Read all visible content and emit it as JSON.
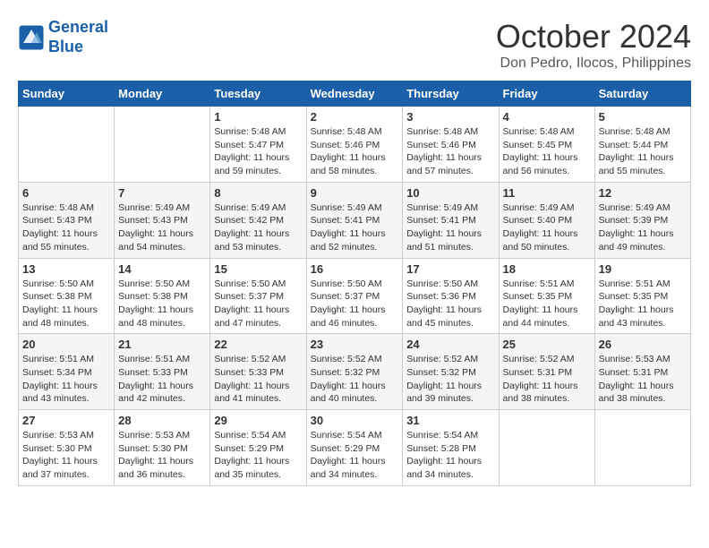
{
  "header": {
    "logo_line1": "General",
    "logo_line2": "Blue",
    "month_year": "October 2024",
    "location": "Don Pedro, Ilocos, Philippines"
  },
  "days_of_week": [
    "Sunday",
    "Monday",
    "Tuesday",
    "Wednesday",
    "Thursday",
    "Friday",
    "Saturday"
  ],
  "weeks": [
    [
      {
        "day": "",
        "info": ""
      },
      {
        "day": "",
        "info": ""
      },
      {
        "day": "1",
        "sunrise": "5:48 AM",
        "sunset": "5:47 PM",
        "daylight": "11 hours and 59 minutes."
      },
      {
        "day": "2",
        "sunrise": "5:48 AM",
        "sunset": "5:46 PM",
        "daylight": "11 hours and 58 minutes."
      },
      {
        "day": "3",
        "sunrise": "5:48 AM",
        "sunset": "5:46 PM",
        "daylight": "11 hours and 57 minutes."
      },
      {
        "day": "4",
        "sunrise": "5:48 AM",
        "sunset": "5:45 PM",
        "daylight": "11 hours and 56 minutes."
      },
      {
        "day": "5",
        "sunrise": "5:48 AM",
        "sunset": "5:44 PM",
        "daylight": "11 hours and 55 minutes."
      }
    ],
    [
      {
        "day": "6",
        "sunrise": "5:48 AM",
        "sunset": "5:43 PM",
        "daylight": "11 hours and 55 minutes."
      },
      {
        "day": "7",
        "sunrise": "5:49 AM",
        "sunset": "5:43 PM",
        "daylight": "11 hours and 54 minutes."
      },
      {
        "day": "8",
        "sunrise": "5:49 AM",
        "sunset": "5:42 PM",
        "daylight": "11 hours and 53 minutes."
      },
      {
        "day": "9",
        "sunrise": "5:49 AM",
        "sunset": "5:41 PM",
        "daylight": "11 hours and 52 minutes."
      },
      {
        "day": "10",
        "sunrise": "5:49 AM",
        "sunset": "5:41 PM",
        "daylight": "11 hours and 51 minutes."
      },
      {
        "day": "11",
        "sunrise": "5:49 AM",
        "sunset": "5:40 PM",
        "daylight": "11 hours and 50 minutes."
      },
      {
        "day": "12",
        "sunrise": "5:49 AM",
        "sunset": "5:39 PM",
        "daylight": "11 hours and 49 minutes."
      }
    ],
    [
      {
        "day": "13",
        "sunrise": "5:50 AM",
        "sunset": "5:38 PM",
        "daylight": "11 hours and 48 minutes."
      },
      {
        "day": "14",
        "sunrise": "5:50 AM",
        "sunset": "5:38 PM",
        "daylight": "11 hours and 48 minutes."
      },
      {
        "day": "15",
        "sunrise": "5:50 AM",
        "sunset": "5:37 PM",
        "daylight": "11 hours and 47 minutes."
      },
      {
        "day": "16",
        "sunrise": "5:50 AM",
        "sunset": "5:37 PM",
        "daylight": "11 hours and 46 minutes."
      },
      {
        "day": "17",
        "sunrise": "5:50 AM",
        "sunset": "5:36 PM",
        "daylight": "11 hours and 45 minutes."
      },
      {
        "day": "18",
        "sunrise": "5:51 AM",
        "sunset": "5:35 PM",
        "daylight": "11 hours and 44 minutes."
      },
      {
        "day": "19",
        "sunrise": "5:51 AM",
        "sunset": "5:35 PM",
        "daylight": "11 hours and 43 minutes."
      }
    ],
    [
      {
        "day": "20",
        "sunrise": "5:51 AM",
        "sunset": "5:34 PM",
        "daylight": "11 hours and 43 minutes."
      },
      {
        "day": "21",
        "sunrise": "5:51 AM",
        "sunset": "5:33 PM",
        "daylight": "11 hours and 42 minutes."
      },
      {
        "day": "22",
        "sunrise": "5:52 AM",
        "sunset": "5:33 PM",
        "daylight": "11 hours and 41 minutes."
      },
      {
        "day": "23",
        "sunrise": "5:52 AM",
        "sunset": "5:32 PM",
        "daylight": "11 hours and 40 minutes."
      },
      {
        "day": "24",
        "sunrise": "5:52 AM",
        "sunset": "5:32 PM",
        "daylight": "11 hours and 39 minutes."
      },
      {
        "day": "25",
        "sunrise": "5:52 AM",
        "sunset": "5:31 PM",
        "daylight": "11 hours and 38 minutes."
      },
      {
        "day": "26",
        "sunrise": "5:53 AM",
        "sunset": "5:31 PM",
        "daylight": "11 hours and 38 minutes."
      }
    ],
    [
      {
        "day": "27",
        "sunrise": "5:53 AM",
        "sunset": "5:30 PM",
        "daylight": "11 hours and 37 minutes."
      },
      {
        "day": "28",
        "sunrise": "5:53 AM",
        "sunset": "5:30 PM",
        "daylight": "11 hours and 36 minutes."
      },
      {
        "day": "29",
        "sunrise": "5:54 AM",
        "sunset": "5:29 PM",
        "daylight": "11 hours and 35 minutes."
      },
      {
        "day": "30",
        "sunrise": "5:54 AM",
        "sunset": "5:29 PM",
        "daylight": "11 hours and 34 minutes."
      },
      {
        "day": "31",
        "sunrise": "5:54 AM",
        "sunset": "5:28 PM",
        "daylight": "11 hours and 34 minutes."
      },
      {
        "day": "",
        "info": ""
      },
      {
        "day": "",
        "info": ""
      }
    ]
  ],
  "labels": {
    "sunrise_prefix": "Sunrise: ",
    "sunset_prefix": "Sunset: ",
    "daylight_prefix": "Daylight: "
  }
}
